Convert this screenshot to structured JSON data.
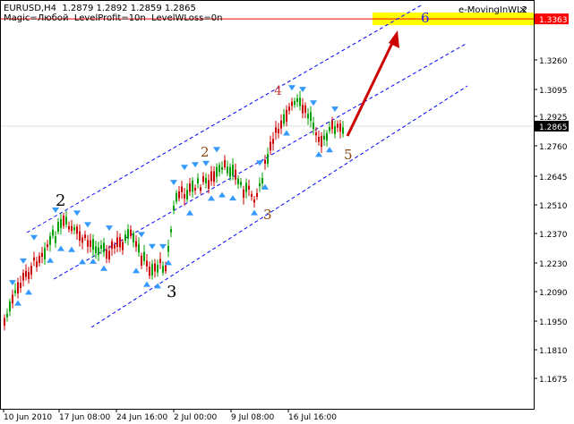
{
  "header": {
    "symbol_line": "EURUSD,H4  1.2879 1.2892 1.2859 1.2865",
    "params_line": "Magic=Любой  LevelProfit=10n  LevelWLoss=0n",
    "indicator_name": "e-MovingInWL2",
    "close_glyph": "×"
  },
  "price_axis": {
    "ticks": [
      "1.3260",
      "1.3095",
      "1.2925",
      "1.2760",
      "1.2645",
      "1.2510",
      "1.2370",
      "1.2230",
      "1.2090",
      "1.1950",
      "1.1810",
      "1.1675"
    ],
    "target_label": "1.3363",
    "current_label": "1.2865"
  },
  "time_axis": {
    "labels": [
      "10 Jun 2010",
      "17 Jun 08:00",
      "24 Jun 16:00",
      "2 Jul 00:00",
      "9 Jul 08:00",
      "16 Jul 16:00"
    ]
  },
  "wave_labels": [
    {
      "text": "2",
      "color": "#000000"
    },
    {
      "text": "3",
      "color": "#000000"
    },
    {
      "text": "2",
      "color": "#8b4513"
    },
    {
      "text": "3",
      "color": "#8b4513"
    },
    {
      "text": "4",
      "color": "#cc3333"
    },
    {
      "text": "5",
      "color": "#8b4513"
    },
    {
      "text": "6",
      "color": "#1a1aff"
    }
  ],
  "colors": {
    "bull_candle": "#00a000",
    "bear_candle": "#cc0000",
    "channel": "#0000ff",
    "fractal": "#3399ff",
    "target_zone": "#ffff00",
    "target_line": "#ff0000",
    "arrow": "#cc0000"
  },
  "chart_data": {
    "type": "candlestick",
    "symbol": "EURUSD",
    "timeframe": "H4",
    "last_bar": {
      "open": 1.2879,
      "high": 1.2892,
      "low": 1.2859,
      "close": 1.2865
    },
    "y_range": [
      1.164,
      1.343
    ],
    "target_level": 1.3363,
    "current_price": 1.2865
  }
}
